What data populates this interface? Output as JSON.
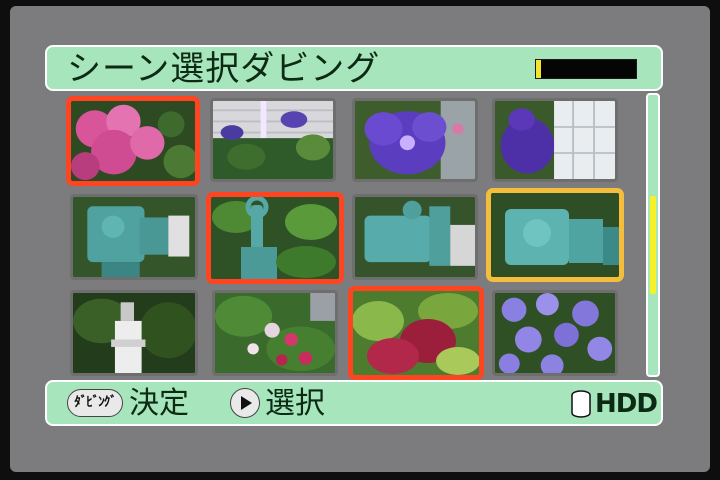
{
  "header": {
    "title": "シーン選択ダビング",
    "capacity_fraction": 0.05,
    "capacity_color": "#f4e42a"
  },
  "thumbnails": [
    {
      "scene": "pink-azalea-bush",
      "marked": true,
      "cursor": false
    },
    {
      "scene": "purple-flowers-white-wall",
      "marked": false,
      "cursor": false
    },
    {
      "scene": "purple-flower-closeup",
      "marked": false,
      "cursor": false
    },
    {
      "scene": "purple-flower-window",
      "marked": false,
      "cursor": false
    },
    {
      "scene": "green-water-pump",
      "marked": false,
      "cursor": false
    },
    {
      "scene": "pump-handle-greenery",
      "marked": true,
      "cursor": false
    },
    {
      "scene": "green-water-pump-2",
      "marked": false,
      "cursor": false
    },
    {
      "scene": "green-water-pump-3",
      "marked": false,
      "cursor": true
    },
    {
      "scene": "white-statue-garden",
      "marked": false,
      "cursor": false
    },
    {
      "scene": "pink-red-flowers",
      "marked": false,
      "cursor": false
    },
    {
      "scene": "coleus-leaves",
      "marked": true,
      "cursor": false
    },
    {
      "scene": "purple-petunias",
      "marked": false,
      "cursor": false
    }
  ],
  "scrollbar": {
    "position_fraction": 0.36,
    "visible_fraction": 0.35
  },
  "footer": {
    "dub_button_label": "ﾀﾞﾋﾞﾝｸﾞ",
    "decide_label": "決定",
    "select_label": "選択",
    "media_label": "HDD"
  },
  "colors": {
    "panel": "#a7e6bd",
    "marked_border": "#ff4422",
    "cursor_border": "#f4be3c"
  }
}
